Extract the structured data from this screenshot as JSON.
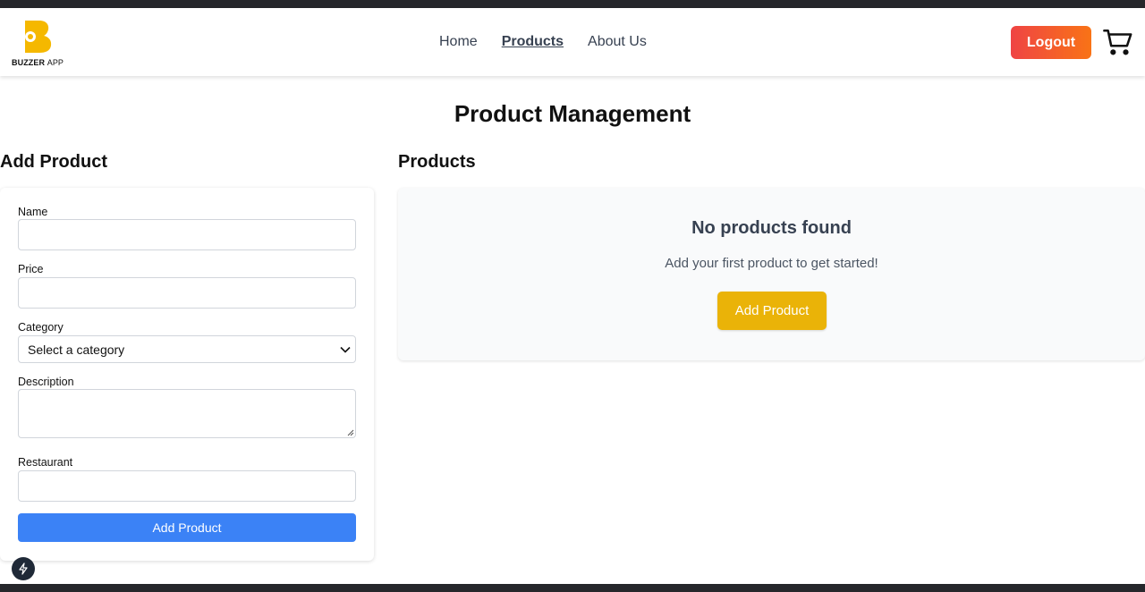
{
  "brand": {
    "name": "BUZZER",
    "suffix": "APP",
    "accent": "#f5b800"
  },
  "nav": {
    "items": [
      "Home",
      "Products",
      "About Us"
    ],
    "active": "Products"
  },
  "header": {
    "logout_label": "Logout"
  },
  "page": {
    "title": "Product Management"
  },
  "add_form": {
    "heading": "Add Product",
    "name_label": "Name",
    "price_label": "Price",
    "category_label": "Category",
    "category_selected": "Select a category",
    "description_label": "Description",
    "restaurant_label": "Restaurant",
    "submit_label": "Add Product"
  },
  "products": {
    "heading": "Products",
    "empty_title": "No products found",
    "empty_subtitle": "Add your first product to get started!",
    "empty_button": "Add Product"
  },
  "colors": {
    "submit_blue": "#3b82f6",
    "empty_button_yellow": "#eab308",
    "logout_gradient": [
      "#ef4444",
      "#f97316"
    ]
  },
  "icons": [
    "buzzer-logo-icon",
    "cart-icon",
    "chevron-down-icon",
    "resize-grip-icon",
    "bolt-icon"
  ]
}
